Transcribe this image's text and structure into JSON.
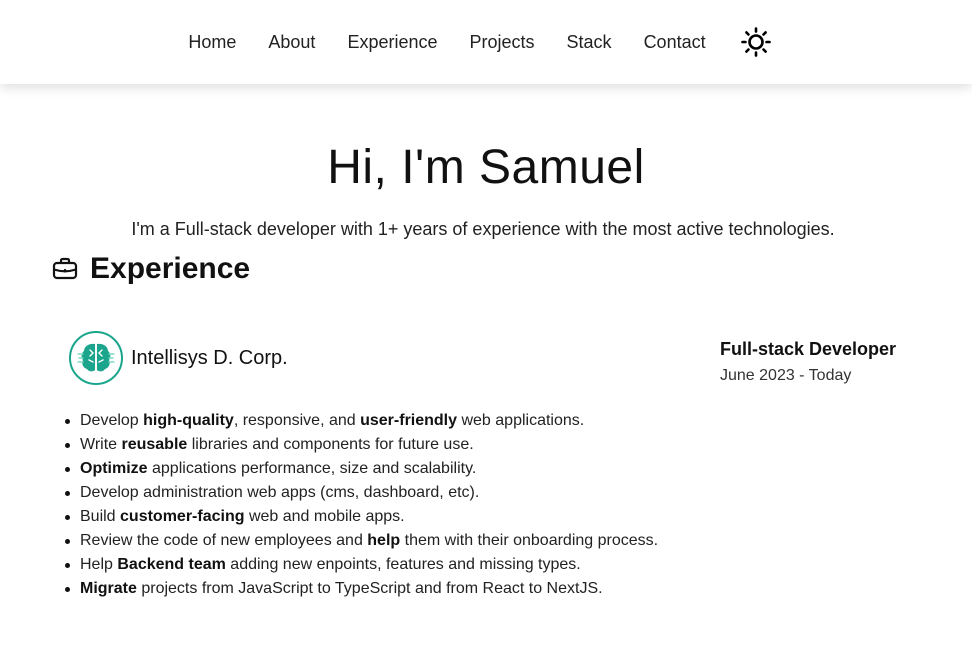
{
  "nav": {
    "items": [
      "Home",
      "About",
      "Experience",
      "Projects",
      "Stack",
      "Contact"
    ],
    "theme_toggle_icon": "sun-icon"
  },
  "hero": {
    "title": "Hi, I'm Samuel",
    "subtitle": "I'm a Full-stack developer with 1+ years of experience with the most active technologies."
  },
  "experience": {
    "icon": "briefcase-icon",
    "heading": "Experience",
    "jobs": [
      {
        "company": "Intellisys D. Corp.",
        "logo_icon": "brain-icon",
        "logo_color": "#1aa58c",
        "role": "Full-stack Developer",
        "dates": "June 2023 - Today",
        "duties": [
          [
            {
              "t": "Develop ",
              "b": false
            },
            {
              "t": "high-quality",
              "b": true
            },
            {
              "t": ", responsive, and ",
              "b": false
            },
            {
              "t": "user-friendly",
              "b": true
            },
            {
              "t": " web applications.",
              "b": false
            }
          ],
          [
            {
              "t": "Write ",
              "b": false
            },
            {
              "t": "reusable",
              "b": true
            },
            {
              "t": " libraries and components for future use.",
              "b": false
            }
          ],
          [
            {
              "t": "Optimize",
              "b": true
            },
            {
              "t": " applications performance, size and scalability.",
              "b": false
            }
          ],
          [
            {
              "t": "Develop administration web apps (cms, dashboard, etc).",
              "b": false
            }
          ],
          [
            {
              "t": "Build ",
              "b": false
            },
            {
              "t": "customer-facing",
              "b": true
            },
            {
              "t": " web and mobile apps.",
              "b": false
            }
          ],
          [
            {
              "t": "Review the code of new employees and ",
              "b": false
            },
            {
              "t": "help",
              "b": true
            },
            {
              "t": " them with their onboarding process.",
              "b": false
            }
          ],
          [
            {
              "t": "Help ",
              "b": false
            },
            {
              "t": "Backend team",
              "b": true
            },
            {
              "t": " adding new enpoints, features and missing types.",
              "b": false
            }
          ],
          [
            {
              "t": "Migrate",
              "b": true
            },
            {
              "t": " projects from JavaScript to TypeScript and from React to NextJS.",
              "b": false
            }
          ]
        ]
      }
    ]
  }
}
